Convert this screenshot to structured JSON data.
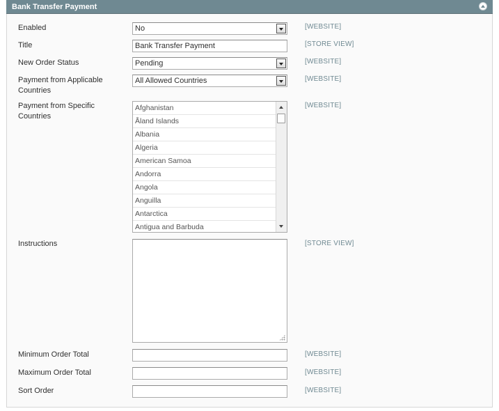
{
  "section": {
    "title": "Bank Transfer Payment"
  },
  "fields": {
    "enabled": {
      "label": "Enabled",
      "value": "No",
      "scope": "[WEBSITE]"
    },
    "title": {
      "label": "Title",
      "value": "Bank Transfer Payment",
      "scope": "[STORE VIEW]"
    },
    "order_status": {
      "label": "New Order Status",
      "value": "Pending",
      "scope": "[WEBSITE]"
    },
    "applicable_countries": {
      "label": "Payment from Applicable Countries",
      "value": "All Allowed Countries",
      "scope": "[WEBSITE]"
    },
    "specific_countries": {
      "label": "Payment from Specific Countries",
      "scope": "[WEBSITE]",
      "options": [
        "Afghanistan",
        "Åland Islands",
        "Albania",
        "Algeria",
        "American Samoa",
        "Andorra",
        "Angola",
        "Anguilla",
        "Antarctica",
        "Antigua and Barbuda"
      ]
    },
    "instructions": {
      "label": "Instructions",
      "value": "",
      "scope": "[STORE VIEW]"
    },
    "min_order_total": {
      "label": "Minimum Order Total",
      "value": "",
      "scope": "[WEBSITE]"
    },
    "max_order_total": {
      "label": "Maximum Order Total",
      "value": "",
      "scope": "[WEBSITE]"
    },
    "sort_order": {
      "label": "Sort Order",
      "value": "",
      "scope": "[WEBSITE]"
    }
  },
  "icons": {
    "collapse": "collapse-up-icon",
    "select_arrow": "chevron-down-icon"
  },
  "colors": {
    "header_bg": "#6f8992",
    "scope_text": "#6f8992",
    "fieldset_bg": "#fafafa"
  }
}
